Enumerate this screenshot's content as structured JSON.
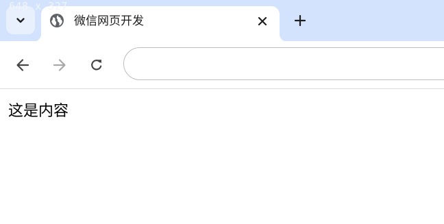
{
  "window": {
    "size_overlay": "648 x 327"
  },
  "tab": {
    "title": "微信网页开发",
    "favicon": "globe-icon",
    "close_icon": "close-icon"
  },
  "tabstrip": {
    "search_icon": "chevron-down-icon",
    "new_tab_icon": "plus-icon"
  },
  "toolbar": {
    "back_icon": "arrow-left-icon",
    "forward_icon": "arrow-right-icon",
    "reload_icon": "reload-icon",
    "address_value": "",
    "address_placeholder": ""
  },
  "page": {
    "text": "这是内容"
  },
  "colors": {
    "tabstrip_bg": "#d3e3fd",
    "tab_search_bg": "#e8effd",
    "icon": "#444746",
    "icon_disabled": "#a8a8a8"
  }
}
